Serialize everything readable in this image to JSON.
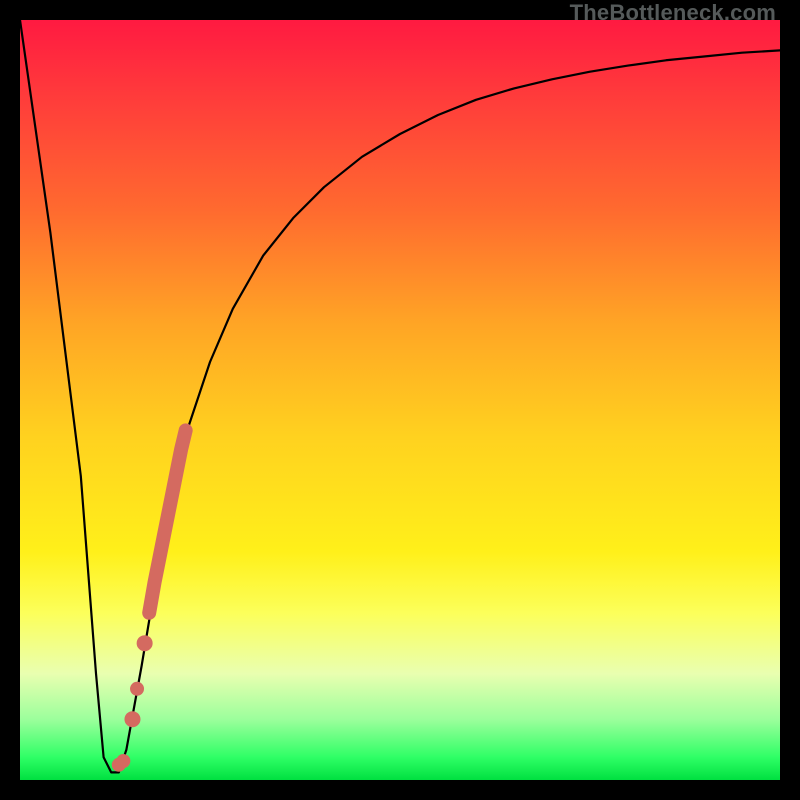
{
  "watermark": "TheBottleneck.com",
  "chart_data": {
    "type": "line",
    "title": "",
    "xlabel": "",
    "ylabel": "",
    "xlim": [
      0,
      100
    ],
    "ylim": [
      0,
      100
    ],
    "series": [
      {
        "name": "bottleneck-curve",
        "x": [
          0,
          4,
          8,
          10,
          11,
          12,
          13,
          14,
          16,
          18,
          20,
          22,
          25,
          28,
          32,
          36,
          40,
          45,
          50,
          55,
          60,
          65,
          70,
          75,
          80,
          85,
          90,
          95,
          100
        ],
        "values": [
          100,
          72,
          40,
          14,
          3,
          1,
          1,
          4,
          15,
          27,
          38,
          46,
          55,
          62,
          69,
          74,
          78,
          82,
          85,
          87.5,
          89.5,
          91,
          92.2,
          93.2,
          94,
          94.7,
          95.2,
          95.7,
          96
        ]
      }
    ],
    "markers": {
      "name": "highlight-segment",
      "color": "#d46a60",
      "points": [
        {
          "x": 13.0,
          "y": 2
        },
        {
          "x": 13.6,
          "y": 2.5
        },
        {
          "x": 14.8,
          "y": 8
        },
        {
          "x": 15.4,
          "y": 12
        },
        {
          "x": 16.4,
          "y": 18
        },
        {
          "x": 17.0,
          "y": 22
        },
        {
          "x": 17.7,
          "y": 26
        },
        {
          "x": 18.3,
          "y": 29
        },
        {
          "x": 18.9,
          "y": 32
        },
        {
          "x": 19.5,
          "y": 35
        },
        {
          "x": 20.1,
          "y": 38
        },
        {
          "x": 20.7,
          "y": 41
        },
        {
          "x": 21.2,
          "y": 43.5
        },
        {
          "x": 21.8,
          "y": 46
        }
      ]
    }
  }
}
